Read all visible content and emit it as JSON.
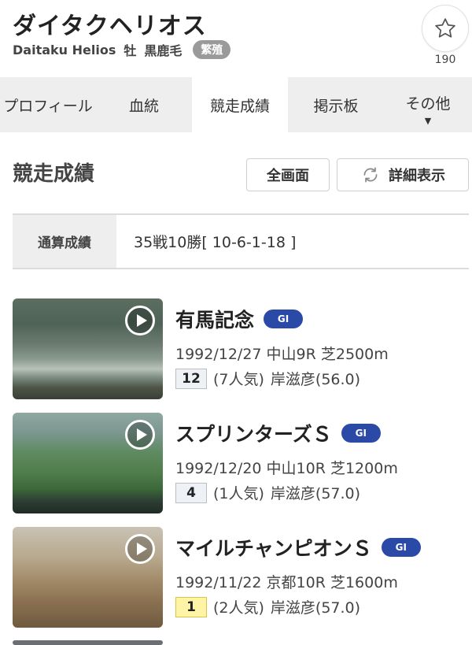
{
  "horse": {
    "name": "ダイタクヘリオス",
    "name_en": "Daitaku Helios",
    "sex": "牡",
    "color": "黒鹿毛",
    "status_badge": "繁殖"
  },
  "favorite": {
    "count": "190",
    "icon": "star-outline-icon"
  },
  "tabs": [
    {
      "label": "プロフィール",
      "active": false
    },
    {
      "label": "血統",
      "active": false
    },
    {
      "label": "競走成績",
      "active": true
    },
    {
      "label": "掲示板",
      "active": false
    },
    {
      "label": "その他",
      "active": false,
      "caret": "▼"
    }
  ],
  "section": {
    "title": "競走成績",
    "fullscreen_label": "全画面",
    "detail_label": "詳細表示"
  },
  "summary": {
    "label": "通算成績",
    "value": "35戦10勝[ 10-6-1-18 ]"
  },
  "races": [
    {
      "name": "有馬記念",
      "grade": "GI",
      "info": "1992/12/27 中山9R 芝2500m",
      "position": "12",
      "popularity": "(7人気)",
      "jockey": "岸滋彦(56.0)"
    },
    {
      "name": "スプリンターズＳ",
      "grade": "GI",
      "info": "1992/12/20 中山10R 芝1200m",
      "position": "4",
      "popularity": "(1人気)",
      "jockey": "岸滋彦(57.0)"
    },
    {
      "name": "マイルチャンピオンＳ",
      "grade": "GI",
      "info": "1992/11/22 京都10R 芝1600m",
      "position": "1",
      "popularity": "(2人気)",
      "jockey": "岸滋彦(57.0)"
    }
  ],
  "colors": {
    "grade_badge": "#2b4aa8",
    "win_highlight": "#fff3a6",
    "tab_bg": "#eeeeee"
  }
}
